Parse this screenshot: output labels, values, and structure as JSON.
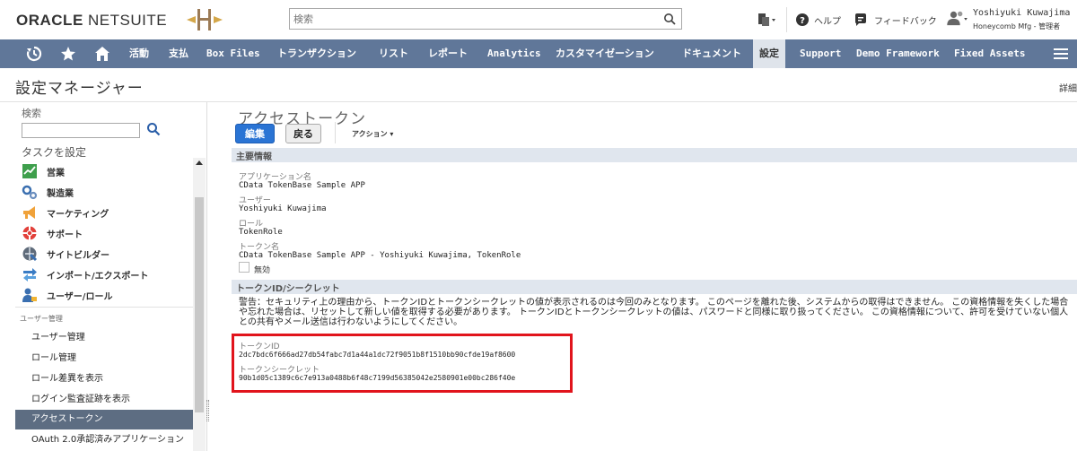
{
  "header": {
    "logo_bold": "ORACLE",
    "logo_light": "NETSUITE",
    "search_placeholder": "検索",
    "help": "ヘルプ",
    "feedback": "フィードバック",
    "user_name": "Yoshiyuki Kuwajima",
    "user_role": "Honeycomb Mfg - 管理者"
  },
  "nav": {
    "items": [
      {
        "label": "活動"
      },
      {
        "label": "支払"
      },
      {
        "label": "Box Files"
      },
      {
        "label": "トランザクション"
      },
      {
        "label": "リスト"
      },
      {
        "label": "レポート"
      },
      {
        "label": "Analytics"
      },
      {
        "label": "カスタマイゼーション"
      },
      {
        "label": "ドキュメント"
      },
      {
        "label": "設定"
      },
      {
        "label": "Support"
      },
      {
        "label": "Demo Framework"
      },
      {
        "label": "Fixed Assets"
      }
    ],
    "active": "設定"
  },
  "page": {
    "title": "設定マネージャー",
    "detail": "詳細"
  },
  "sidebar": {
    "search_label": "検索",
    "task_label": "タスクを設定",
    "categories": [
      {
        "label": "営業",
        "icon": "sales-icon"
      },
      {
        "label": "製造業",
        "icon": "manufacturing-icon"
      },
      {
        "label": "マーケティング",
        "icon": "marketing-icon"
      },
      {
        "label": "サポート",
        "icon": "support-icon"
      },
      {
        "label": "サイトビルダー",
        "icon": "sitebuilder-icon"
      },
      {
        "label": "インポート/エクスポート",
        "icon": "import-export-icon"
      },
      {
        "label": "ユーザー/ロール",
        "icon": "users-roles-icon"
      }
    ],
    "section_label": "ユーザー管理",
    "links": [
      {
        "label": "ユーザー管理"
      },
      {
        "label": "ロール管理"
      },
      {
        "label": "ロール差異を表示"
      },
      {
        "label": "ログイン監査証跡を表示"
      },
      {
        "label": "アクセストークン"
      },
      {
        "label": "OAuth 2.0承認済みアプリケーション"
      }
    ],
    "active_link": "アクセストークン"
  },
  "main": {
    "title": "アクセストークン",
    "edit_button": "編集",
    "back_button": "戻る",
    "actions_label": "アクション ▾",
    "section_primary": "主要情報",
    "fields": {
      "app_label": "アプリケーション名",
      "app_value": "CData TokenBase Sample APP",
      "user_label": "ユーザー",
      "user_value": "Yoshiyuki Kuwajima",
      "role_label": "ロール",
      "role_value": "TokenRole",
      "token_name_label": "トークン名",
      "token_name_value": "CData TokenBase Sample APP - Yoshiyuki Kuwajima, TokenRole",
      "inactive_label": "無効"
    },
    "section_token": "トークンID/シークレット",
    "warning": "警告：セキュリティ上の理由から、トークンIDとトークンシークレットの値が表示されるのは今回のみとなります。 このページを離れた後、システムからの取得はできません。 この資格情報を失くした場合や忘れた場合は、リセットして新しい値を取得する必要があります。 トークンIDとトークンシークレットの値は、パスワードと同様に取り扱ってください。 この資格情報について、許可を受けていない個人との共有やメール送信は行わないようにしてください。",
    "token_id_label": "トークンID",
    "token_id_value": "2dc7bdc6f666ad27db54fabc7d1a44a1dc72f9051b8f1510bb90cfde19af8600",
    "token_secret_label": "トークンシークレット",
    "token_secret_value": "90b1d05c1389c6c7e913a0488b6f48c7199d56385042e2580901e00bc286f40e"
  },
  "colors": {
    "nav_bg": "#607799",
    "edit_button": "#2a74d4",
    "highlight": "#e1141c",
    "section_bar": "#e0e6ee"
  }
}
